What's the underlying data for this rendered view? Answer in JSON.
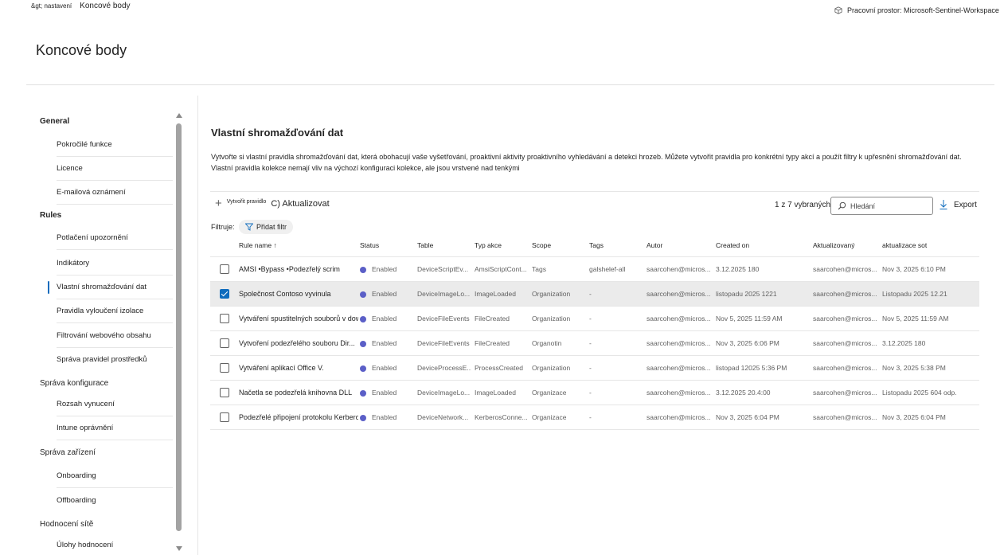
{
  "breadcrumb": {
    "previous": "&gt; nastavení",
    "current": "Koncové body"
  },
  "workspace": {
    "label": "Pracovní prostor: Microsoft-Sentinel-Workspace"
  },
  "page": {
    "title": "Koncové body"
  },
  "sidebar": {
    "groups": [
      {
        "label": "General",
        "items": [
          "Pokročilé funkce",
          "Licence",
          "E-mailová oznámení"
        ]
      },
      {
        "label": "Rules",
        "items": [
          "Potlačení upozornění",
          "Indikátory",
          "Vlastní shromažďování dat",
          "Pravidla vyloučení izolace",
          "Filtrování webového obsahu",
          "Správa pravidel prostředků"
        ]
      },
      {
        "label": "Správa konfigurace",
        "items": [
          "Rozsah vynucení",
          "Intune oprávnění"
        ]
      },
      {
        "label": "Správa zařízení",
        "items": [
          "Onboarding",
          "Offboarding"
        ]
      },
      {
        "label": "Hodnocení sítě",
        "items": [
          "Úlohy hodnocení"
        ]
      }
    ],
    "selected": "Vlastní shromažďování dat"
  },
  "main": {
    "section_title": "Vlastní shromažďování dat",
    "description_line1": "Vytvořte si vlastní pravidla shromažďování dat, která obohacují vaše vyšetřování, proaktivní aktivity proaktivního vyhledávání a detekci hrozeb. Můžete vytvořit pravidla pro konkrétní typy akcí a použít filtry k upřesnění shromažďování dat.",
    "description_line2": "Vlastní pravidla kolekce nemají vliv na výchozí konfiguraci kolekce, ale jsou vrstvené nad tenkými",
    "toolbar": {
      "create_label": "Vytvořit pravidlo",
      "refresh_label": "C) Aktualizovat",
      "count_label": "1 z 7 vybraných",
      "search_placeholder": "Hledání",
      "export_label": "Export"
    },
    "filters": {
      "label": "Filtruje:",
      "add_filter": "Přidat filtr"
    }
  },
  "table": {
    "headers": {
      "rule_name": "Rule name ↑",
      "status": "Status",
      "table": "Table",
      "action_type": "Typ akce",
      "scope": "Scope",
      "tags": "Tags",
      "author": "Autor",
      "created_on": "Created on",
      "updated_by": "Aktualizovaný",
      "updated_on": "aktualizace sot"
    },
    "rows": [
      {
        "checked": false,
        "name": "AMSI •Bypass •Podezřelý scrim",
        "status": "Enabled",
        "table": "DeviceScriptEv...",
        "action": "AmsiScriptCont...",
        "scope": "Tags",
        "tags": "galshelef-all",
        "author": "saarcohen@micros...",
        "created": "3.12.2025 180",
        "updated_by": "saarcohen@micros...",
        "updated": "Nov 3, 2025 6:10 PM"
      },
      {
        "checked": true,
        "name": "Společnost Contoso vyvinula",
        "status": "Enabled",
        "table": "DeviceImageLo...",
        "action": "ImageLoaded",
        "scope": "Organization",
        "tags": "-",
        "author": "saarcohen@micros...",
        "created": "listopadu 2025 1221",
        "updated_by": "saarcohen@micros...",
        "updated": "Listopadu 2025 12.21"
      },
      {
        "checked": false,
        "name": "Vytváření spustitelných souborů v dow...",
        "status": "Enabled",
        "table": "DeviceFileEvents",
        "action": "FileCreated",
        "scope": "Organization",
        "tags": "-",
        "author": "saarcohen@micros...",
        "created": "Nov 5, 2025 11:59 AM",
        "updated_by": "saarcohen@micros...",
        "updated": "Nov 5, 2025 11:59 AM"
      },
      {
        "checked": false,
        "name": "Vytvoření podezřelého souboru Dir...",
        "status": "Enabled",
        "table": "DeviceFileEvents",
        "action": "FileCreated",
        "scope": "Organotin",
        "tags": "-",
        "author": "saarcohen@micros...",
        "created": "Nov 3, 2025 6:06 PM",
        "updated_by": "saarcohen@micros...",
        "updated": "3.12.2025 180"
      },
      {
        "checked": false,
        "name": "Vytváření aplikací Office V.",
        "status": "Enabled",
        "table": "DeviceProcessE...",
        "action": "ProcessCreated",
        "scope": "Organization",
        "tags": "-",
        "author": "saarcohen@micros...",
        "created": "listopad 12025 5:36 PM",
        "updated_by": "saarcohen@micros...",
        "updated": "Nov 3, 2025 5:38 PM"
      },
      {
        "checked": false,
        "name": "Načetla se podezřelá knihovna DLL",
        "status": "Enabled",
        "table": "DeviceImageLo...",
        "action": "ImageLoaded",
        "scope": "Organizace",
        "tags": "-",
        "author": "saarcohen@micros...",
        "created": "3.12.2025 20.4:00",
        "updated_by": "saarcohen@micros...",
        "updated": "Listopadu 2025 604 odp."
      },
      {
        "checked": false,
        "name": "Podezřelé připojení protokolu Kerberos",
        "status": "Enabled",
        "table": "DeviceNetwork...",
        "action": "KerberosConne...",
        "scope": "Organizace",
        "tags": "-",
        "author": "saarcohen@micros...",
        "created": "Nov 3, 2025 6:04 PM",
        "updated_by": "saarcohen@micros...",
        "updated": "Nov 3, 2025 6:04 PM"
      }
    ]
  },
  "colors": {
    "accent": "#0f6cbd",
    "status_enabled": "#5b5fc7",
    "selected_row": "#ebebeb"
  },
  "icons": {
    "workspace": "cube-icon",
    "create": "plus-icon",
    "search": "search-icon",
    "export": "download-icon",
    "filter": "filter-icon"
  }
}
